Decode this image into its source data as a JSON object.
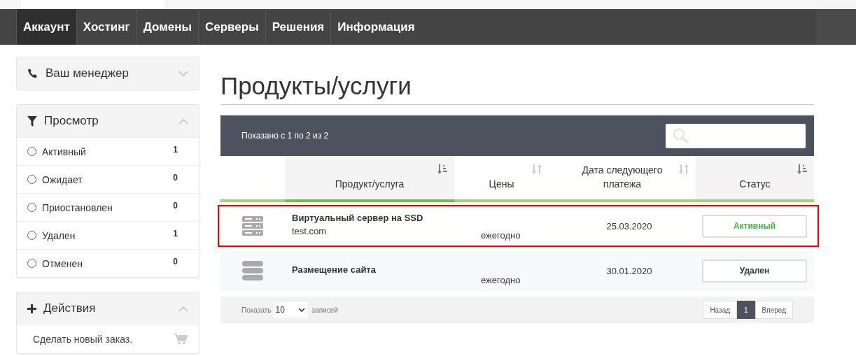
{
  "nav": [
    {
      "label": "Аккаунт",
      "selected": true
    },
    {
      "label": "Хостинг",
      "selected": false
    },
    {
      "label": "Домены",
      "selected": false
    },
    {
      "label": "Серверы",
      "selected": false
    },
    {
      "label": "Решения",
      "selected": false
    },
    {
      "label": "Информация",
      "selected": false
    }
  ],
  "sidebar": [
    {
      "kind": "manager",
      "title": "Ваш менеджер",
      "expanded": false
    },
    {
      "kind": "filter",
      "title": "Просмотр",
      "expanded": true,
      "items": [
        {
          "label": "Активный",
          "count": "1",
          "selected": false
        },
        {
          "label": "Ожидает",
          "count": "0",
          "selected": false
        },
        {
          "label": "Приостановлен",
          "count": "0",
          "selected": false
        },
        {
          "label": "Удален",
          "count": "1",
          "selected": false
        },
        {
          "label": "Отменен",
          "count": "0",
          "selected": false
        }
      ]
    },
    {
      "kind": "actions",
      "title": "Действия",
      "expanded": true,
      "items": [
        {
          "label": "Сделать новый заказ."
        }
      ]
    }
  ],
  "page_title": "Продукты/услуги",
  "table": {
    "info": "Показано с 1 по 2 из 2",
    "columns": [
      {
        "label": "Продукт/услуга",
        "sort_active": true
      },
      {
        "label": "Цены",
        "sort_active": false
      },
      {
        "label": "Дата следующего платежа",
        "sort_active": false
      },
      {
        "label": "Статус",
        "sort_active": true
      }
    ],
    "rows": [
      {
        "kind": "server",
        "name": "Виртуальный сервер на SSD",
        "domain": "test.com",
        "price": "ежегодно",
        "date": "25.03.2020",
        "status": {
          "label": "Активный",
          "color": "#4caf50"
        },
        "highlighted": true
      },
      {
        "kind": "hosting",
        "name": "Размещение сайта",
        "price": "ежегодно",
        "date": "30.01.2020",
        "status": {
          "label": "Удален",
          "color": "#333333"
        },
        "highlighted": false
      }
    ],
    "footer": {
      "show_label": "Показать",
      "page_size": "10",
      "records_label": "записей",
      "prev": "Назад",
      "pages": [
        {
          "label": "1",
          "selected": true
        }
      ],
      "next": "Вперед"
    }
  }
}
